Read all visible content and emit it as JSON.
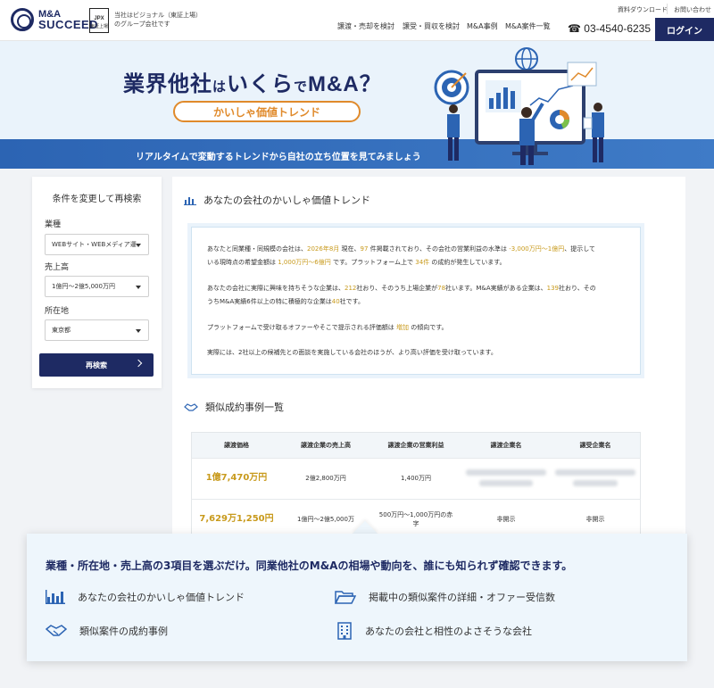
{
  "header": {
    "brand_line1": "M&A",
    "brand_line2": "SUCCEED",
    "jpx_label": "JPX",
    "jpx_sub": "東証上場",
    "group_line1": "当社はビジョナル（東証上場）",
    "group_line2": "のグループ会社です",
    "doc_download": "資料ダウンロード",
    "contact": "お問い合わせ",
    "nav": [
      "譲渡・売却を検討",
      "譲受・買収を検討",
      "M&A事例",
      "M&A案件一覧"
    ],
    "phone": "03-4540-6235",
    "login": "ログイン"
  },
  "hero": {
    "title_part1": "業界他社",
    "title_part2": "は",
    "title_part3": "いくら",
    "title_part4": "で",
    "title_part5": "M&A？",
    "pill": "かいしゃ価値トレンド",
    "band": "リアルタイムで変動するトレンドから自社の立ち位置を見てみましょう"
  },
  "sidebar": {
    "title": "条件を変更して再検索",
    "industry_label": "業種",
    "industry_value": "WEBサイト・WEBメディア運",
    "sales_label": "売上高",
    "sales_value": "1億円〜2億5,000万円",
    "location_label": "所在地",
    "location_value": "東京都",
    "search_button": "再検索"
  },
  "trend": {
    "section_title": "あなたの会社のかいしゃ価値トレンド",
    "p1_a": "あなたと同業種・同規模の会社は、",
    "p1_date": "2026年8月",
    "p1_b": " 現在、",
    "p1_count": "97",
    "p1_c": " 件掲載されており、その会社の営業利益の水準は ",
    "p1_profit": "-3,000万円〜1億円",
    "p1_d": "、提示して",
    "p1_e": "いる現時点の希望金額は ",
    "p1_price": "1,000万円〜6億円",
    "p1_f": " です。プラットフォーム上で ",
    "p1_deals": "34件",
    "p1_g": " の成約が発生しています。",
    "p2_a": "あなたの会社に実際に興味を持ちそうな企業は、",
    "p2_total": "212",
    "p2_b": "社おり、そのうち上場企業が",
    "p2_listed": "78",
    "p2_c": "社います。M&A実績がある企業は、",
    "p2_exp": "139",
    "p2_d": "社おり、その",
    "p2_e": "うちM&A実績6件以上の特に積極的な企業は",
    "p2_active": "40",
    "p2_f": "社です。",
    "p3_a": "プラットフォームで受け取るオファーやそこで提示される評価額は ",
    "p3_trend": "増加",
    "p3_b": " の傾向です。",
    "p4": "実際には、2社以上の候補先との面談を実施している会社のほうが、より高い評価を受け取っています。"
  },
  "cases": {
    "section_title": "類似成約事例一覧",
    "columns": [
      "譲渡価格",
      "譲渡企業の売上高",
      "譲渡企業の営業利益",
      "譲渡企業名",
      "譲受企業名"
    ],
    "rows": [
      {
        "price": "1億7,470万円",
        "sales": "2億2,800万円",
        "profit": "1,400万円",
        "seller": "",
        "buyer": ""
      },
      {
        "price": "7,629万1,250円",
        "sales": "1億円〜2億5,000万",
        "profit_l1": "500万円〜1,000万円の赤",
        "profit_l2": "字",
        "seller": "非開示",
        "buyer": "非開示"
      }
    ]
  },
  "callout": {
    "title": "業種・所在地・売上高の3項目を選ぶだけ。同業他社のM&Aの相場や動向を、誰にも知られず確認できます。",
    "features": [
      "あなたの会社のかいしゃ価値トレンド",
      "掲載中の類似案件の詳細・オファー受信数",
      "類似案件の成約事例",
      "あなたの会社と相性のよさそうな会社"
    ]
  },
  "colors": {
    "navy": "#1e2a63",
    "accent": "#e08a2b",
    "gold": "#c89a1c",
    "band": "#2c64b3"
  }
}
